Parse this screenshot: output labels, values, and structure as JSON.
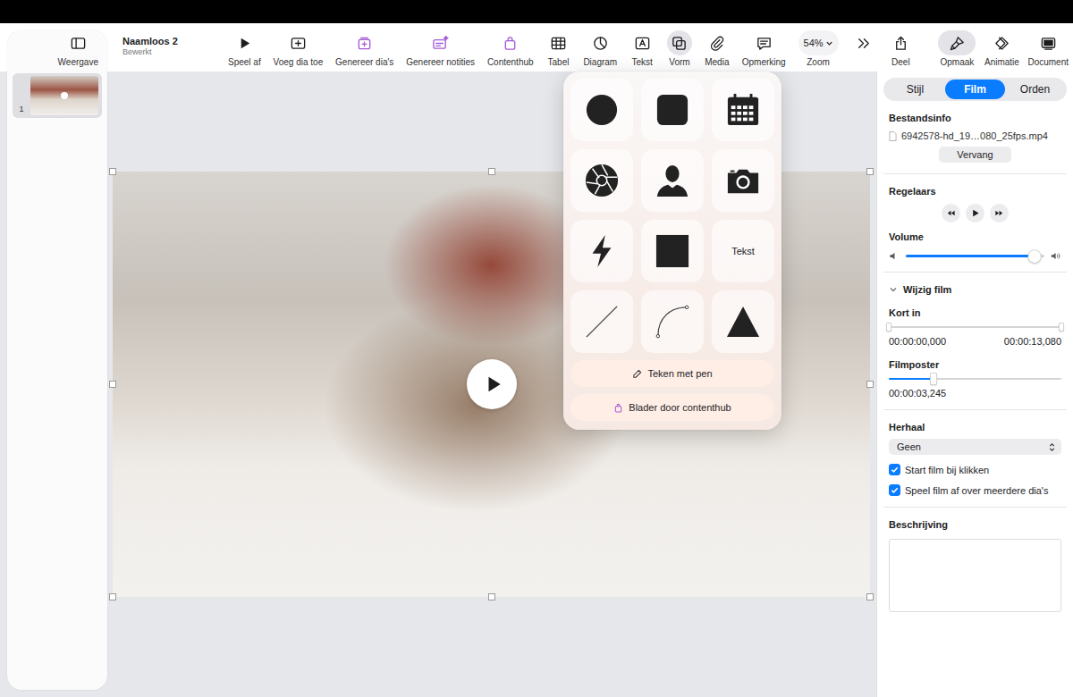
{
  "window": {
    "title": "Naamloos 2",
    "subtitle": "Bewerkt"
  },
  "sidebar": {
    "toggle": {
      "label": "Weergave"
    },
    "slides": [
      {
        "number": "1",
        "selected": true
      }
    ]
  },
  "toolbar": {
    "items": [
      {
        "label": "Speel af",
        "kind": "icon",
        "selected": false,
        "color": "#1d1d1f"
      },
      {
        "label": "Voeg dia toe",
        "kind": "icon",
        "selected": false,
        "color": "#1d1d1f"
      },
      {
        "label": "Genereer dia's",
        "kind": "icon",
        "selected": false,
        "color": "#a45ad6"
      },
      {
        "label": "Genereer notities",
        "kind": "icon",
        "selected": false,
        "color": "#a45ad6"
      },
      {
        "label": "Contenthub",
        "kind": "icon",
        "selected": false,
        "color": "#a45ad6"
      },
      {
        "label": "Tabel",
        "kind": "icon",
        "selected": false,
        "color": "#1d1d1f"
      },
      {
        "label": "Diagram",
        "kind": "icon",
        "selected": false,
        "color": "#1d1d1f"
      },
      {
        "label": "Tekst",
        "kind": "icon",
        "selected": false,
        "color": "#1d1d1f"
      },
      {
        "label": "Vorm",
        "kind": "icon",
        "selected": true,
        "color": "#1d1d1f"
      },
      {
        "label": "Media",
        "kind": "icon",
        "selected": false,
        "color": "#1d1d1f"
      },
      {
        "label": "Opmerking",
        "kind": "icon",
        "selected": false,
        "color": "#1d1d1f"
      },
      {
        "label": "Zoom",
        "kind": "value",
        "value": "54%",
        "selected": false,
        "color": "#1d1d1f"
      },
      {
        "label": "",
        "kind": "overflow",
        "selected": false,
        "color": "#1d1d1f"
      },
      {
        "label": "Deel",
        "kind": "icon",
        "selected": false,
        "color": "#1d1d1f"
      }
    ],
    "right_items": [
      {
        "label": "Opmaak",
        "selected": true
      },
      {
        "label": "Animatie",
        "selected": false
      },
      {
        "label": "Document",
        "selected": false
      }
    ]
  },
  "slide": {
    "selected": true,
    "playing": false
  },
  "shape_popover": {
    "open": true,
    "text_tile": "Tekst",
    "actions": [
      "Teken met pen",
      "Blader door contenthub"
    ]
  },
  "inspector": {
    "tabs": [
      {
        "label": "Stijl",
        "selected": false
      },
      {
        "label": "Film",
        "selected": true
      },
      {
        "label": "Orden",
        "selected": false
      }
    ],
    "file_info": {
      "heading": "Bestandsinfo",
      "filename": "6942578-hd_19…080_25fps.mp4",
      "replace": "Vervang"
    },
    "controls": {
      "heading": "Regelaars"
    },
    "volume": {
      "heading": "Volume",
      "level": 0.93
    },
    "edit_movie": {
      "heading": "Wijzig film",
      "expanded": true
    },
    "trim": {
      "heading": "Kort in",
      "start_level": 0,
      "end_level": 1,
      "start": "00:00:00,000",
      "end": "00:00:13,080"
    },
    "poster": {
      "heading": "Filmposter",
      "level": 0.26,
      "time": "00:00:03,245"
    },
    "repeat": {
      "heading": "Herhaal",
      "value": "Geen"
    },
    "checkboxes": [
      {
        "label": "Start film bij klikken",
        "checked": true
      },
      {
        "label": "Speel film af over meerdere dia's",
        "checked": true
      }
    ],
    "description": {
      "heading": "Beschrijving",
      "value": ""
    }
  }
}
